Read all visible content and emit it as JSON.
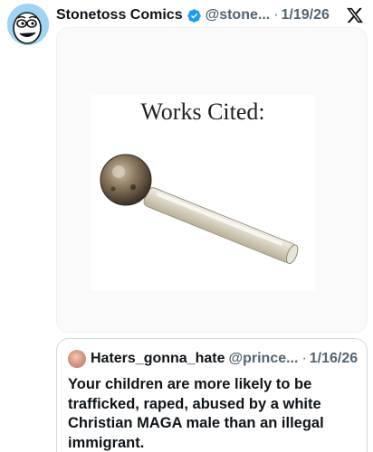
{
  "post": {
    "author": {
      "display_name": "Stonetoss Comics",
      "verified": true,
      "handle": "@stone...",
      "avatar_icon": "cartoon-face-avatar"
    },
    "separator": "·",
    "date": "1/19/26",
    "platform_icon": "x-logo-icon",
    "media": {
      "caption": "Works Cited:",
      "image_subject": "glass-pipe"
    }
  },
  "quoted_post": {
    "author": {
      "display_name": "Haters_gonna_hate",
      "handle": "@prince...",
      "avatar_icon": "pink-avatar"
    },
    "separator": "·",
    "date": "1/16/26",
    "text": "Your children are more likely to be trafficked, raped, abused by a white Christian MAGA male than an illegal immigrant."
  },
  "colors": {
    "text_primary": "#0f1419",
    "text_secondary": "#536471",
    "verified_blue": "#1d9bf0",
    "border": "#cfd9de",
    "avatar_bg": "#9fd4f2"
  }
}
